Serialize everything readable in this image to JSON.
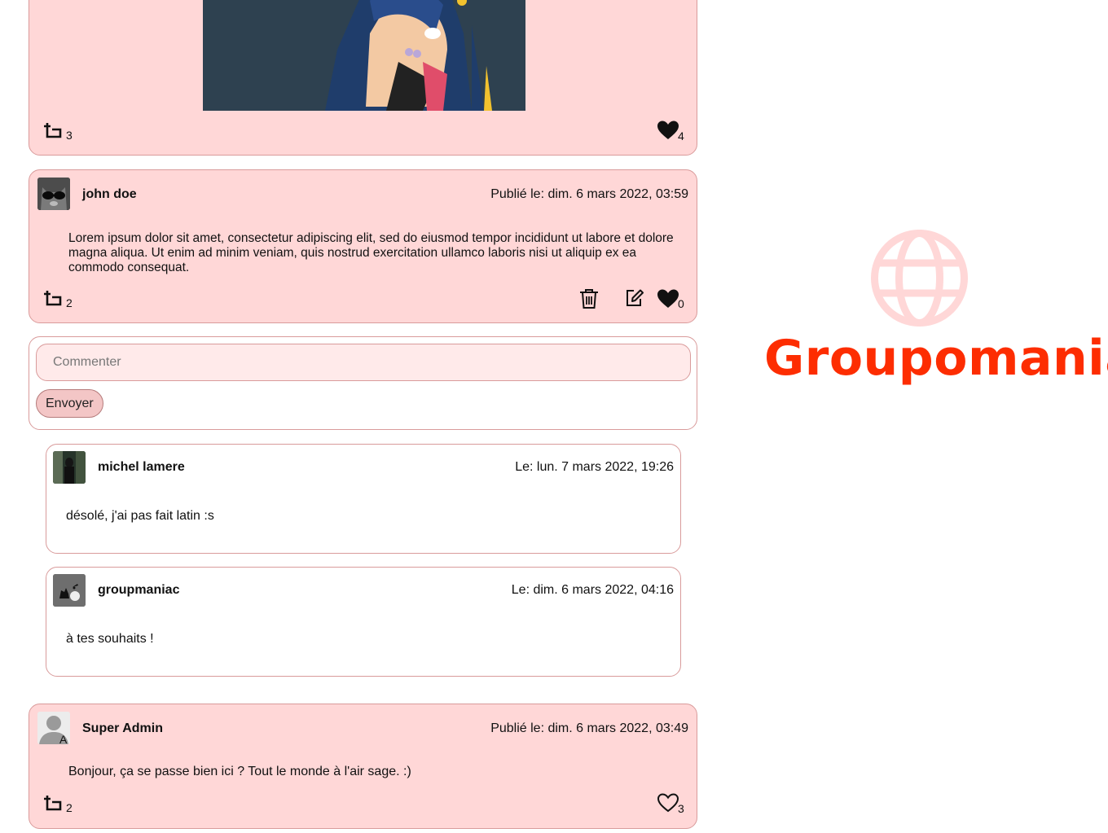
{
  "posts": [
    {
      "shares": "3",
      "likes": "4",
      "liked": true
    },
    {
      "author": "john doe",
      "date": "Publié le: dim. 6 mars 2022, 03:59",
      "text": "Lorem ipsum dolor sit amet, consectetur adipiscing elit, sed do eiusmod tempor incididunt ut labore et dolore magna aliqua. Ut enim ad minim veniam, quis nostrud exercitation ullamco laboris nisi ut aliquip ex ea commodo consequat.",
      "shares": "2",
      "likes": "0",
      "liked": true
    },
    {
      "author": "Super Admin",
      "date": "Publié le: dim. 6 mars 2022, 03:49",
      "text": "Bonjour, ça se passe bien ici ? Tout le monde à l'air sage. :)",
      "shares": "2",
      "likes": "3",
      "liked": false
    }
  ],
  "comment_form": {
    "placeholder": "Commenter",
    "send_label": "Envoyer"
  },
  "comments": [
    {
      "author": "michel lamere",
      "date": "Le: lun. 7 mars 2022, 19:26",
      "text": "désolé, j'ai pas fait latin :s"
    },
    {
      "author": "groupmaniac",
      "date": "Le: dim. 6 mars 2022, 04:16",
      "text": "à tes souhaits !"
    }
  ],
  "brand": {
    "name": "Groupomania",
    "color": "#fd2d01",
    "globe_color": "#ffd7d7"
  },
  "colors": {
    "card_bg": "#ffd7d7",
    "card_border": "#d99b9b"
  }
}
